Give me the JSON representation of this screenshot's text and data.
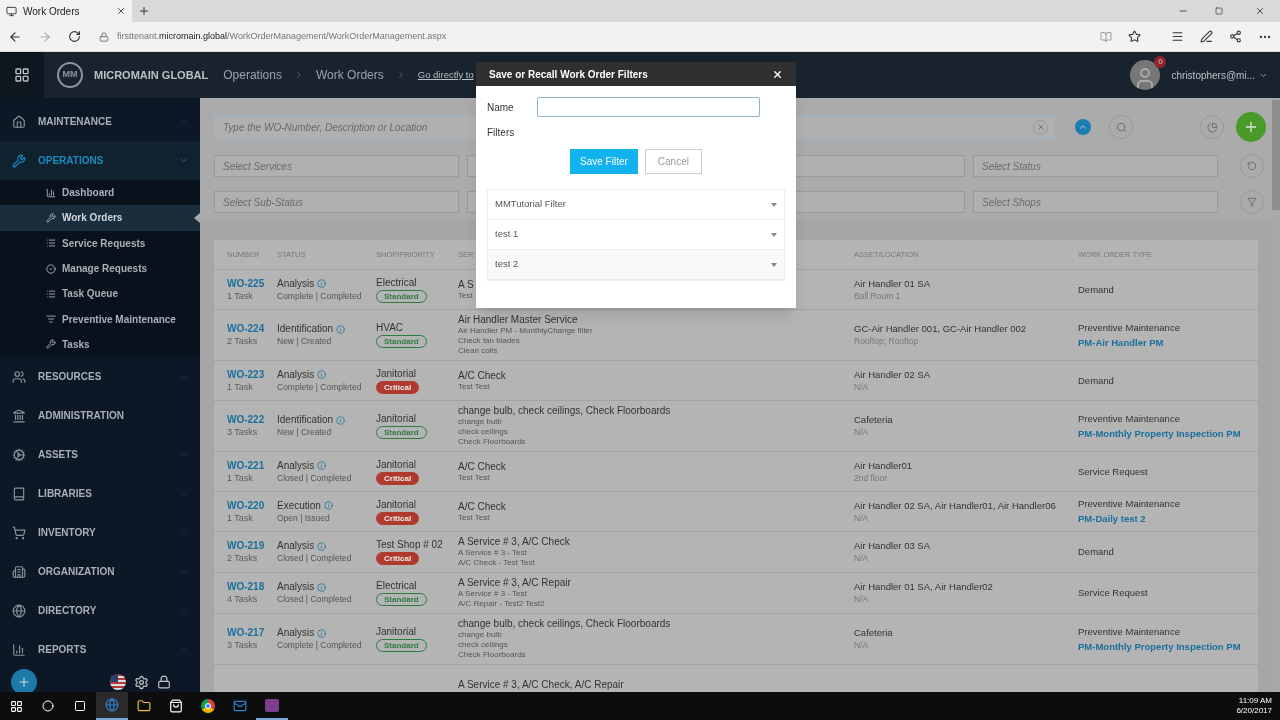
{
  "browser": {
    "tab_title": "Work Orders",
    "url": "firsttenant.**micromain.global**/WorkOrderManagement/WorkOrderManagement.aspx"
  },
  "app_header": {
    "logo": "MM",
    "brand": "MICROMAIN GLOBAL",
    "breadcrumbs": [
      "Operations",
      "Work Orders"
    ],
    "go_link": "Go directly to",
    "notifications": "0",
    "user": "christophers@mi..."
  },
  "sidebar": {
    "items": [
      {
        "label": "MAINTENANCE",
        "expanded": false
      },
      {
        "label": "OPERATIONS",
        "expanded": true,
        "children": [
          {
            "label": "Dashboard",
            "selected": false
          },
          {
            "label": "Work Orders",
            "selected": true
          },
          {
            "label": "Service Requests",
            "selected": false
          },
          {
            "label": "Manage Requests",
            "selected": false
          },
          {
            "label": "Task Queue",
            "selected": false
          },
          {
            "label": "Preventive Maintenance",
            "selected": false
          },
          {
            "label": "Tasks",
            "selected": false
          }
        ]
      },
      {
        "label": "RESOURCES",
        "expanded": false
      },
      {
        "label": "ADMINISTRATION",
        "expanded": false
      },
      {
        "label": "ASSETS",
        "expanded": false
      },
      {
        "label": "LIBRARIES",
        "expanded": false
      },
      {
        "label": "INVENTORY",
        "expanded": false
      },
      {
        "label": "ORGANIZATION",
        "expanded": false
      },
      {
        "label": "DIRECTORY",
        "expanded": false
      },
      {
        "label": "REPORTS",
        "expanded": false
      }
    ]
  },
  "search": {
    "placeholder": "Type the WO-Number, Description or Location"
  },
  "filter_rows": [
    {
      "left": "Select Services",
      "right": "Select Status"
    },
    {
      "left": "Select Sub-Status",
      "right": "Select Shops"
    }
  ],
  "table": {
    "columns": [
      "NUMBER",
      "STATUS",
      "SHOP/PRIORITY",
      "SER",
      "ASSET/LOCATION",
      "WORK ORDER TYPE"
    ],
    "rows": [
      {
        "number": "WO-225",
        "tasks": "1 Task",
        "status": "Analysis",
        "status_detail": "Complete | Completed",
        "shop": "Electrical",
        "priority": {
          "label": "Standard",
          "kind": "standard"
        },
        "service": "A S",
        "service_lines": [
          "Test"
        ],
        "asset": "Air Handler 01 SA",
        "location": "Ball Room 1",
        "type": "Demand"
      },
      {
        "number": "WO-224",
        "tasks": "2 Tasks",
        "status": "Identification",
        "status_detail": "New | Created",
        "shop": "HVAC",
        "priority": {
          "label": "Standard",
          "kind": "standard"
        },
        "service": "Air Handler Master Service",
        "service_lines": [
          "Air Handler PM - MonthlyChange filter",
          "Check fan blades",
          "Clean coils"
        ],
        "asset": "GC-Air Handler 001, GC-Air Handler 002",
        "location": "Rooftop; Rooftop",
        "type": "Preventive Maintenance",
        "pm_link": "PM-Air Handler PM"
      },
      {
        "number": "WO-223",
        "tasks": "1 Task",
        "status": "Analysis",
        "status_detail": "Complete | Completed",
        "shop": "Janitorial",
        "priority": {
          "label": "Critical",
          "kind": "critical"
        },
        "service": "A/C Check",
        "service_lines": [
          "Test Test"
        ],
        "asset": "Air Handler 02 SA",
        "location": "N/A",
        "type": "Demand"
      },
      {
        "number": "WO-222",
        "tasks": "3 Tasks",
        "status": "Identification",
        "status_detail": "New | Created",
        "shop": "Janitorial",
        "priority": {
          "label": "Standard",
          "kind": "standard"
        },
        "service": "change bulb, check ceilings, Check Floorboards",
        "service_lines": [
          "change bulb",
          "check ceilings",
          "Check Floorboards"
        ],
        "asset": "Cafeteria",
        "location": "N/A",
        "type": "Preventive Maintenance",
        "pm_link": "PM-Monthly Property Inspection PM"
      },
      {
        "number": "WO-221",
        "tasks": "1 Task",
        "status": "Analysis",
        "status_detail": "Closed | Completed",
        "shop": "Janitorial",
        "priority": {
          "label": "Critical",
          "kind": "critical"
        },
        "service": "A/C Check",
        "service_lines": [
          "Test Test"
        ],
        "asset": "Air Handler01",
        "location": "2nd floor",
        "type": "Service Request"
      },
      {
        "number": "WO-220",
        "tasks": "1 Task",
        "status": "Execution",
        "status_detail": "Open | Issued",
        "shop": "Janitorial",
        "priority": {
          "label": "Critical",
          "kind": "critical"
        },
        "service": "A/C Check",
        "service_lines": [
          "Test Test"
        ],
        "asset": "Air Handler 02 SA, Air Handler01, Air Handler06",
        "location": "N/A",
        "type": "Preventive Maintenance",
        "pm_link": "PM-Daily test 2"
      },
      {
        "number": "WO-219",
        "tasks": "2 Tasks",
        "status": "Analysis",
        "status_detail": "Closed | Completed",
        "shop": "Test Shop # 02",
        "priority": {
          "label": "Critical",
          "kind": "critical"
        },
        "service": "A Service # 3, A/C Check",
        "service_lines": [
          "A Service # 3 - Test",
          "A/C Check - Test Test"
        ],
        "asset": "Air Handler 03 SA",
        "location": "N/A",
        "type": "Demand"
      },
      {
        "number": "WO-218",
        "tasks": "4 Tasks",
        "status": "Analysis",
        "status_detail": "Closed | Completed",
        "shop": "Electrical",
        "priority": {
          "label": "Standard",
          "kind": "standard"
        },
        "service": "A Service # 3, A/C Repair",
        "service_lines": [
          "A Service # 3 - Test",
          "A/C Repair - Test2 Test2"
        ],
        "asset": "Air Handler 01 SA, Air Handler02",
        "location": "N/A",
        "type": "Service Request"
      },
      {
        "number": "WO-217",
        "tasks": "3 Tasks",
        "status": "Analysis",
        "status_detail": "Complete | Completed",
        "shop": "Janitorial",
        "priority": {
          "label": "Standard",
          "kind": "standard"
        },
        "service": "change bulb, check ceilings, Check Floorboards",
        "service_lines": [
          "change bulb",
          "check ceilings",
          "Check Floorboards"
        ],
        "asset": "Cafeteria",
        "location": "N/A",
        "type": "Preventive Maintenance",
        "pm_link": "PM-Monthly Property Inspection PM"
      },
      {
        "service": "A Service # 3, A/C Check, A/C Repair"
      }
    ]
  },
  "modal": {
    "title": "Save or Recall Work Order Filters",
    "name_label": "Name",
    "filters_label": "Filters",
    "save": "Save Filter",
    "cancel": "Cancel",
    "saved_filters": [
      "MMTutorial Filter",
      "test 1",
      "test 2"
    ]
  },
  "taskbar": {
    "time": "11:09 AM",
    "date": "6/20/2017"
  }
}
